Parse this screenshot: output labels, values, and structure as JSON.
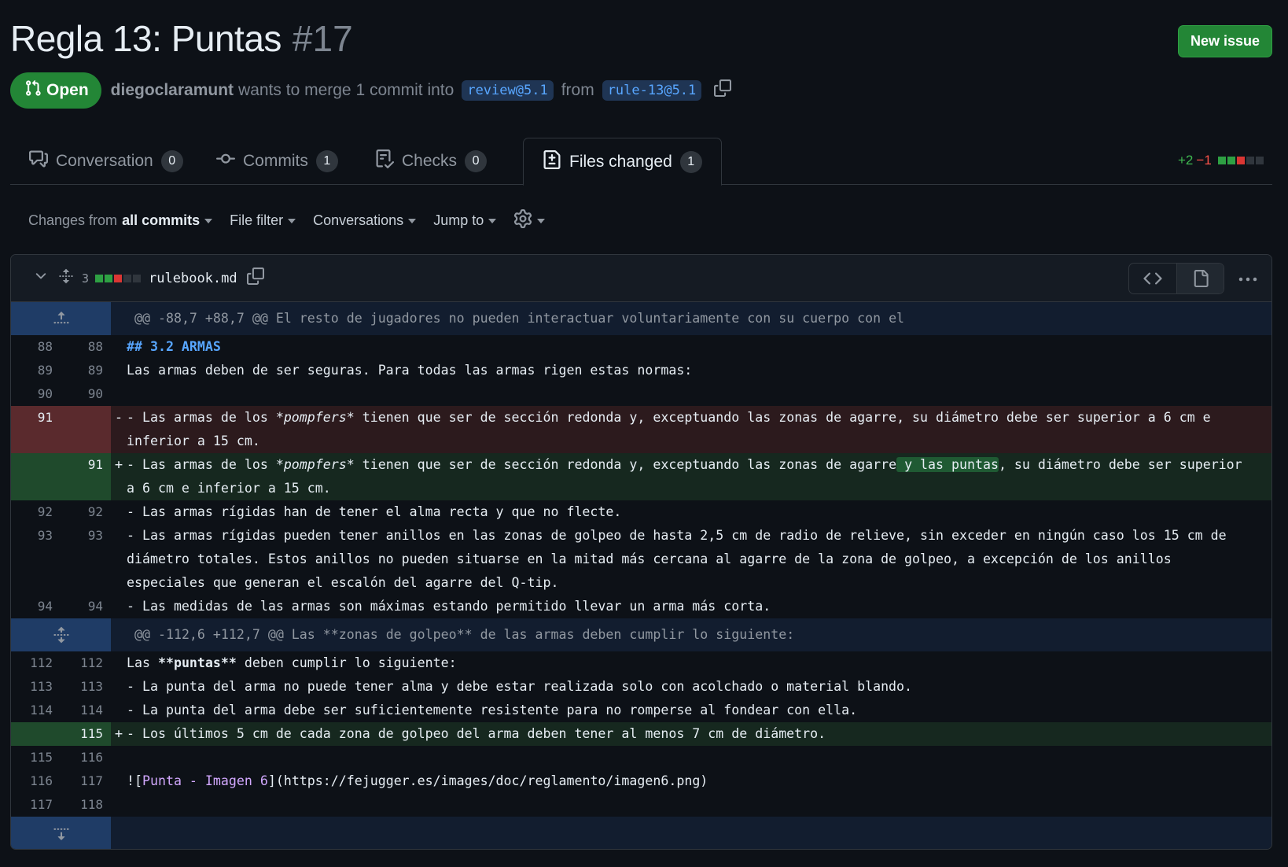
{
  "header": {
    "title": "Regla 13: Puntas",
    "number": "#17",
    "new_issue_label": "New issue"
  },
  "state": {
    "label": "Open",
    "author": "diegoclaramunt",
    "text1": "wants to merge 1 commit into",
    "base_branch": "review@5.1",
    "text2": "from",
    "head_branch": "rule-13@5.1"
  },
  "tabs": [
    {
      "label": "Conversation",
      "count": "0"
    },
    {
      "label": "Commits",
      "count": "1"
    },
    {
      "label": "Checks",
      "count": "0"
    },
    {
      "label": "Files changed",
      "count": "1"
    }
  ],
  "diffstat": {
    "additions": "+2",
    "deletions": "−1"
  },
  "toolbar": {
    "changes_prefix": "Changes from",
    "changes_value": "all commits",
    "file_filter": "File filter",
    "conversations": "Conversations",
    "jump_to": "Jump to"
  },
  "file": {
    "change_count": "3",
    "name": "rulebook.md"
  },
  "hunks": {
    "h1": "@@ -88,7 +88,7 @@ El resto de jugadores no pueden interactuar voluntariamente con su cuerpo con el",
    "h2": "@@ -112,6 +112,7 @@ Las **zonas de golpeo** de las armas deben cumplir lo siguiente:"
  },
  "lines": {
    "l88": {
      "old": "88",
      "new": "88",
      "text": "## 3.2 ARMAS"
    },
    "l89": {
      "old": "89",
      "new": "89",
      "text": "Las armas deben de ser seguras. Para todas las armas rigen estas normas:"
    },
    "l90": {
      "old": "90",
      "new": "90",
      "text": ""
    },
    "l91del": {
      "old": "91",
      "sign": "-",
      "a": "- Las armas de los ",
      "b": "*pompfers*",
      "c": " tienen que ser de sección redonda y, exceptuando las zonas de agarre, su diámetro debe ser superior a 6 cm e inferior a 15 cm."
    },
    "l91add": {
      "new": "91",
      "sign": "+",
      "a": "- Las armas de los ",
      "b": "*pompfers*",
      "c": " tienen que ser de sección redonda y, exceptuando las zonas de agarre",
      "d": " y las puntas",
      "e": ", su diámetro debe ser superior a 6 cm e inferior a 15 cm."
    },
    "l92": {
      "old": "92",
      "new": "92",
      "text": "- Las armas rígidas han de tener el alma recta y que no flecte."
    },
    "l93": {
      "old": "93",
      "new": "93",
      "text": "- Las armas rígidas pueden tener anillos en las zonas de golpeo de hasta 2,5 cm de radio de relieve, sin exceder en ningún caso los 15 cm de diámetro totales. Estos anillos no pueden situarse en la mitad más cercana al agarre de la zona de golpeo, a excepción de los anillos especiales que generan el escalón del agarre del Q-tip."
    },
    "l94": {
      "old": "94",
      "new": "94",
      "text": "- Las medidas de las armas son máximas estando permitido llevar un arma más corta."
    },
    "l112": {
      "old": "112",
      "new": "112",
      "a": "Las ",
      "b": "**puntas**",
      "c": " deben cumplir lo siguiente:"
    },
    "l113": {
      "old": "113",
      "new": "113",
      "text": "- La punta del arma no puede tener alma y debe estar realizada solo con acolchado o material blando."
    },
    "l114": {
      "old": "114",
      "new": "114",
      "text": "- La punta del arma debe ser suficientemente resistente para no romperse al fondear con ella."
    },
    "l115add": {
      "new": "115",
      "sign": "+",
      "text": "- Los últimos 5 cm de cada zona de golpeo del arma deben tener al menos 7 cm de diámetro."
    },
    "l116": {
      "old": "115",
      "new": "116",
      "text": ""
    },
    "l117": {
      "old": "116",
      "new": "117",
      "a": "![",
      "b": "Punta - Imagen 6",
      "c": "](https://fejugger.es/images/doc/reglamento/imagen6.png)"
    },
    "l118": {
      "old": "117",
      "new": "118",
      "text": ""
    }
  },
  "colors": {
    "accent_green": "#238636",
    "link_blue": "#58a6ff",
    "bg": "#0d1117"
  }
}
